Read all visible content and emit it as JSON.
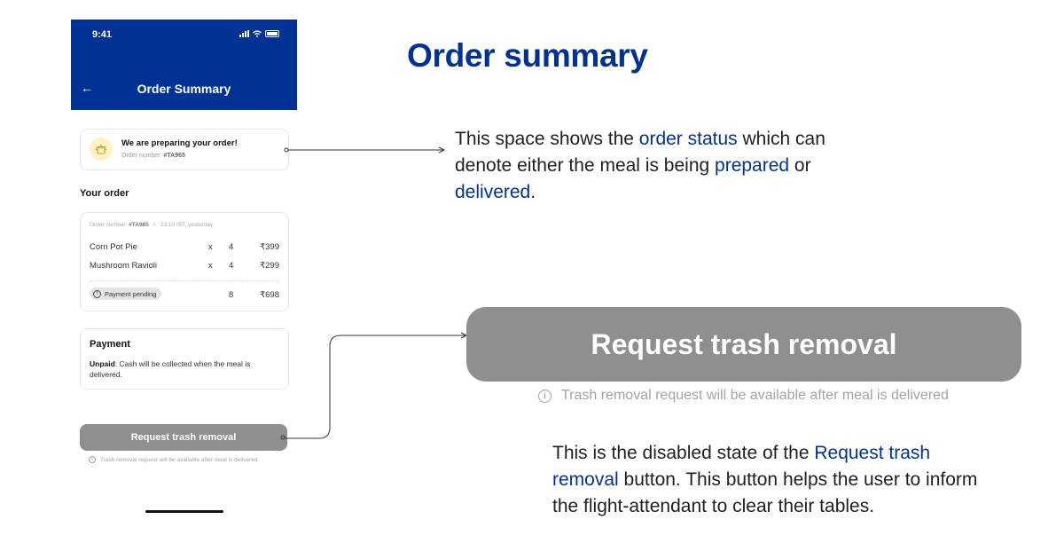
{
  "phone": {
    "status_bar": {
      "time": "9:41",
      "icons": [
        "signal-icon",
        "wifi-icon",
        "battery-icon"
      ]
    },
    "header": {
      "back_icon": "arrow-left-icon",
      "title": "Order Summary",
      "color": "#003296"
    },
    "status_card": {
      "icon": "cooking-pot-icon",
      "title": "We are preparing your order!",
      "order_label": "Order number:",
      "order_number": "#TA965"
    },
    "your_order_heading": "Your order",
    "order_card": {
      "order_label": "Order number:",
      "order_number": "#TA965",
      "separator": "•",
      "timestamp": "23:10 IST, yesterday",
      "items": [
        {
          "name": "Corn Pot Pie",
          "x": "x",
          "qty": "4",
          "price": "₹399"
        },
        {
          "name": "Mushroom Ravioli",
          "x": "x",
          "qty": "4",
          "price": "₹299"
        }
      ],
      "badge": {
        "icon": "info-icon",
        "label": "Payment pending"
      },
      "total_qty": "8",
      "total_price": "₹698"
    },
    "payment_card": {
      "title": "Payment",
      "status": "Unpaid",
      "text": ": Cash will be collected when the meal is delivered."
    },
    "trash_button": {
      "label": "Request trash removal",
      "hint": "Trash removal request will be available after meal is delivered"
    }
  },
  "annotations": {
    "page_title": "Order summary",
    "status_desc": {
      "part1": "This space shows the ",
      "hl1": "order status",
      "part2": " which can denote either the meal is being ",
      "hl2": "prepared",
      "part3": " or ",
      "hl3": "delivered",
      "part4": "."
    },
    "big_button": {
      "label": "Request trash removal",
      "hint": "Trash removal request will be available after meal is delivered"
    },
    "button_desc": {
      "part1": "This is the disabled state of the ",
      "hl1": "Request trash removal",
      "part2": " button. This button helps the user to inform the flight-attendant to clear their tables."
    }
  },
  "colors": {
    "brand_blue": "#003296",
    "disabled_button": "#8f8f8f",
    "hint_gray": "#a3a3a3",
    "pot_bg": "#fdf3c4"
  }
}
